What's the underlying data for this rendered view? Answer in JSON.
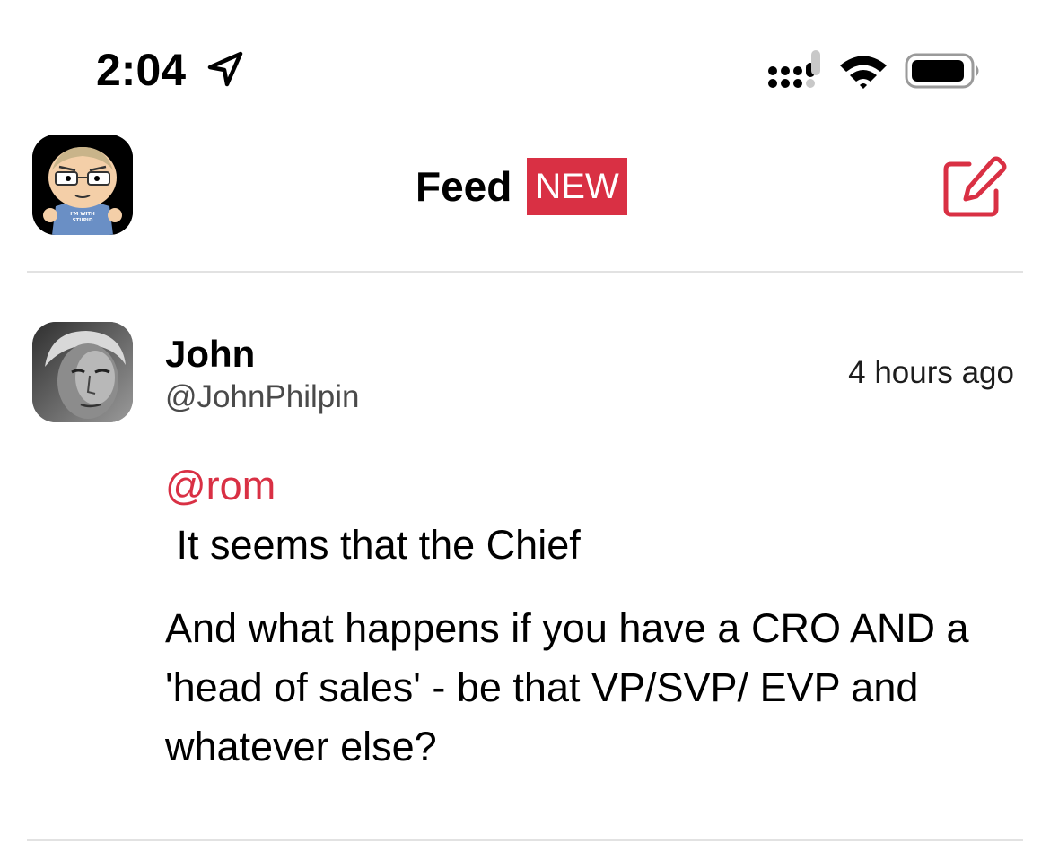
{
  "status_bar": {
    "time": "2:04",
    "location_icon": "location-arrow-icon",
    "signal_icon": "cellular-signal-icon",
    "wifi_icon": "wifi-icon",
    "battery_icon": "battery-icon"
  },
  "header": {
    "title": "Feed",
    "badge": "NEW",
    "avatar_icon": "app-avatar",
    "compose_icon": "compose-icon",
    "accent_color": "#d93044"
  },
  "post": {
    "author": "John",
    "handle": "@JohnPhilpin",
    "timestamp": "4 hours ago",
    "mention": "@rom",
    "line1": " It seems that the Chief",
    "paragraph": "And what happens if you have a CRO AND a 'head of sales' - be that VP/SVP/ EVP and whatever else?"
  }
}
